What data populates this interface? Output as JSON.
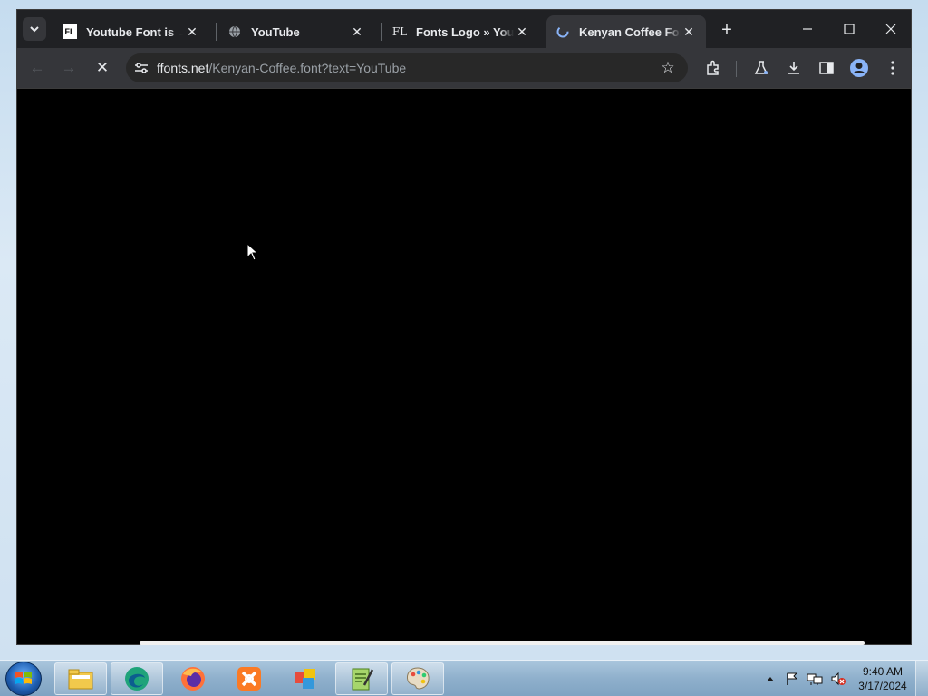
{
  "browser": {
    "tabs": [
      {
        "title": "Youtube Font is → Tr",
        "favicon": "FL",
        "active": false
      },
      {
        "title": "YouTube",
        "favicon": "globe",
        "active": false
      },
      {
        "title": "Fonts Logo » Youtub",
        "favicon": "FL",
        "active": false
      },
      {
        "title": "Kenyan Coffee Font",
        "favicon": "loading",
        "active": true
      }
    ],
    "close_glyph": "✕",
    "new_tab_glyph": "+",
    "window_controls": {
      "minimize": "—",
      "maximize": "☐",
      "close": "✕"
    },
    "toolbar": {
      "back_icon": "←",
      "forward_icon": "→",
      "stop_icon": "✕",
      "url_host": "ffonts.net",
      "url_path": "/Kenyan-Coffee.font?text=YouTube",
      "star_icon": "☆"
    }
  },
  "taskbar": {
    "clock_time": "9:40 AM",
    "clock_date": "3/17/2024",
    "apps": [
      "file-explorer",
      "edge",
      "firefox",
      "xampp",
      "office",
      "notepad-plus",
      "paint"
    ]
  },
  "colors": {
    "tab_bg": "#202124",
    "toolbar_bg": "#35363a",
    "page_bg": "#000000",
    "text": "#e8eaed"
  }
}
